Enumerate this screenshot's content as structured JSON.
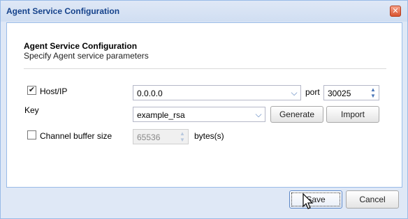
{
  "window": {
    "title": "Agent Service Configuration",
    "close_glyph": "✕"
  },
  "header": {
    "title": "Agent Service Configuration",
    "subtitle": "Specify Agent service parameters"
  },
  "form": {
    "host": {
      "checked": true,
      "label": "Host/IP",
      "value": "0.0.0.0",
      "port_label": "port",
      "port_value": "30025"
    },
    "key": {
      "label": "Key",
      "value": "example_rsa",
      "generate_label": "Generate",
      "import_label": "Import"
    },
    "buffer": {
      "checked": false,
      "label": "Channel buffer size",
      "value": "65536",
      "unit": "bytes(s)"
    }
  },
  "footer": {
    "save_label": "Save",
    "cancel_label": "Cancel"
  },
  "colors": {
    "title_text": "#15428b",
    "frame_border": "#99bbe8",
    "frame_bg": "#dfe8f6",
    "close_bg": "#d9532f"
  }
}
